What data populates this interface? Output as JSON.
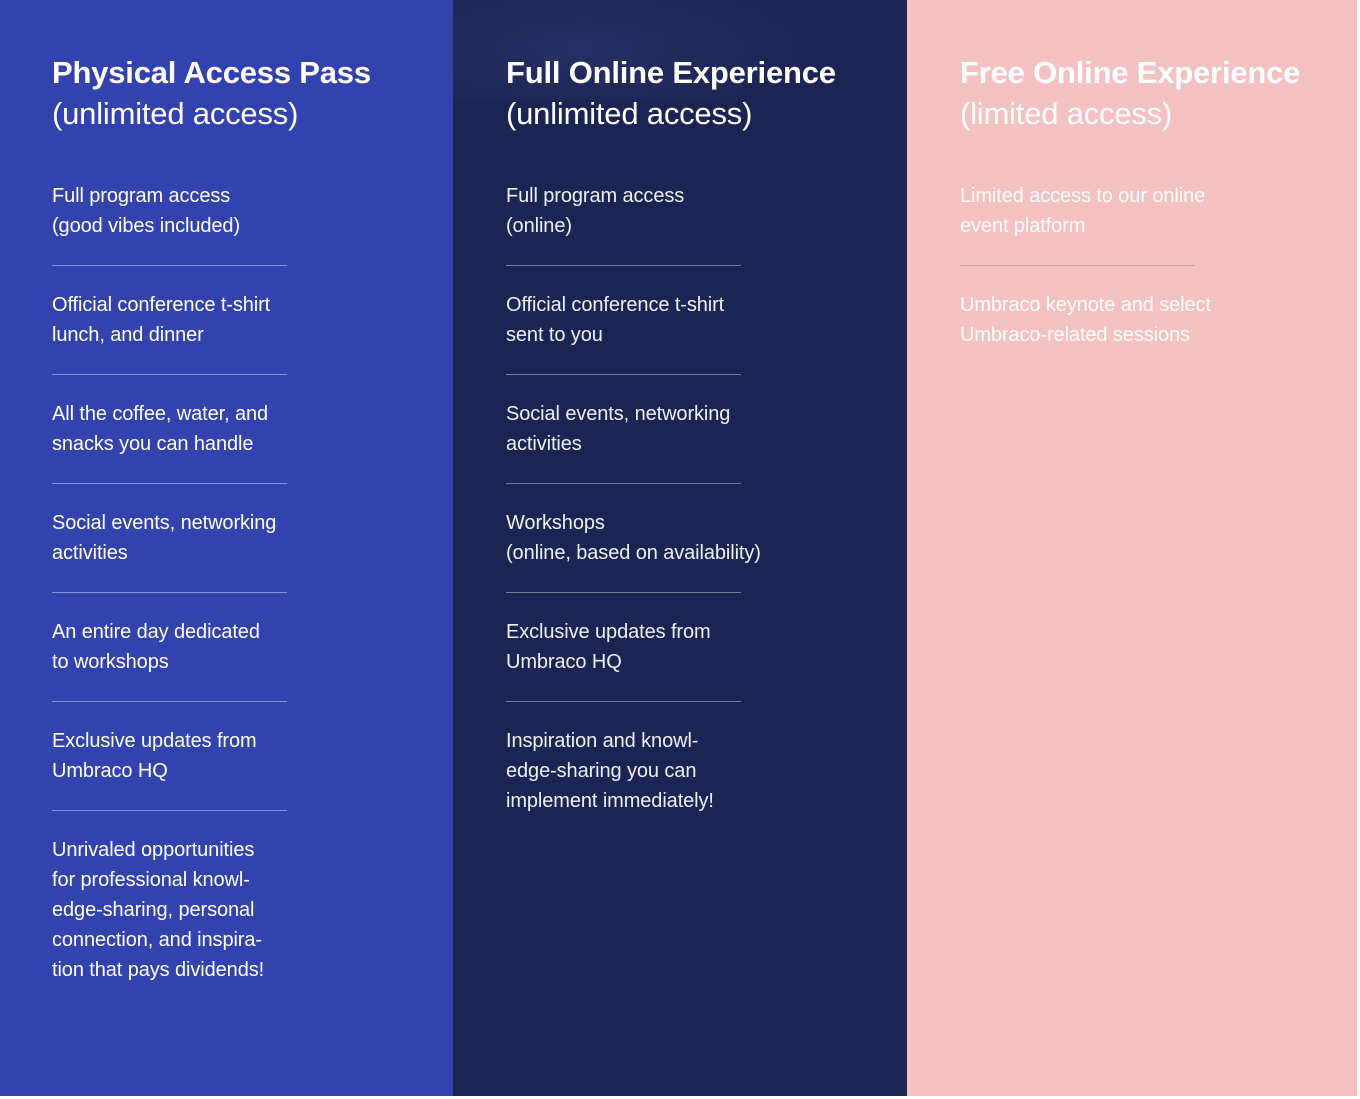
{
  "theme": {
    "physical_bg": "#3442b0",
    "full_bg": "#1b2553",
    "free_bg": "#f4c2c0",
    "text_light": "#ffffff"
  },
  "columns": [
    {
      "id": "physical-access-pass",
      "title_strong": "Physical Access Pass",
      "title_sub": "(unlimited access)",
      "features": [
        "Full program access\n(good vibes included)",
        "Official conference t-shirt\nlunch, and dinner",
        "All the coffee, water, and\nsnacks you can handle",
        "Social events, networking\nactivities",
        "An entire day dedicated\nto workshops",
        "Exclusive updates from\nUmbraco HQ",
        "Unrivaled opportunities\nfor professional knowl-\nedge-sharing, personal\nconnection, and inspira-\ntion that pays dividends!"
      ]
    },
    {
      "id": "full-online-experience",
      "title_strong": "Full Online Experience",
      "title_sub": "(unlimited access)",
      "features": [
        "Full program access\n(online)",
        "Official conference t-shirt\nsent to you",
        "Social events, networking\nactivities",
        "Workshops\n(online, based on availability)",
        "Exclusive updates from\nUmbraco HQ",
        "Inspiration and knowl-\nedge-sharing you can\nimplement immediately!"
      ]
    },
    {
      "id": "free-online-experience",
      "title_strong": "Free Online Experience",
      "title_sub": "(limited access)",
      "features": [
        "Limited access to our online\nevent platform",
        "Umbraco keynote and select\nUmbraco-related sessions"
      ]
    }
  ]
}
